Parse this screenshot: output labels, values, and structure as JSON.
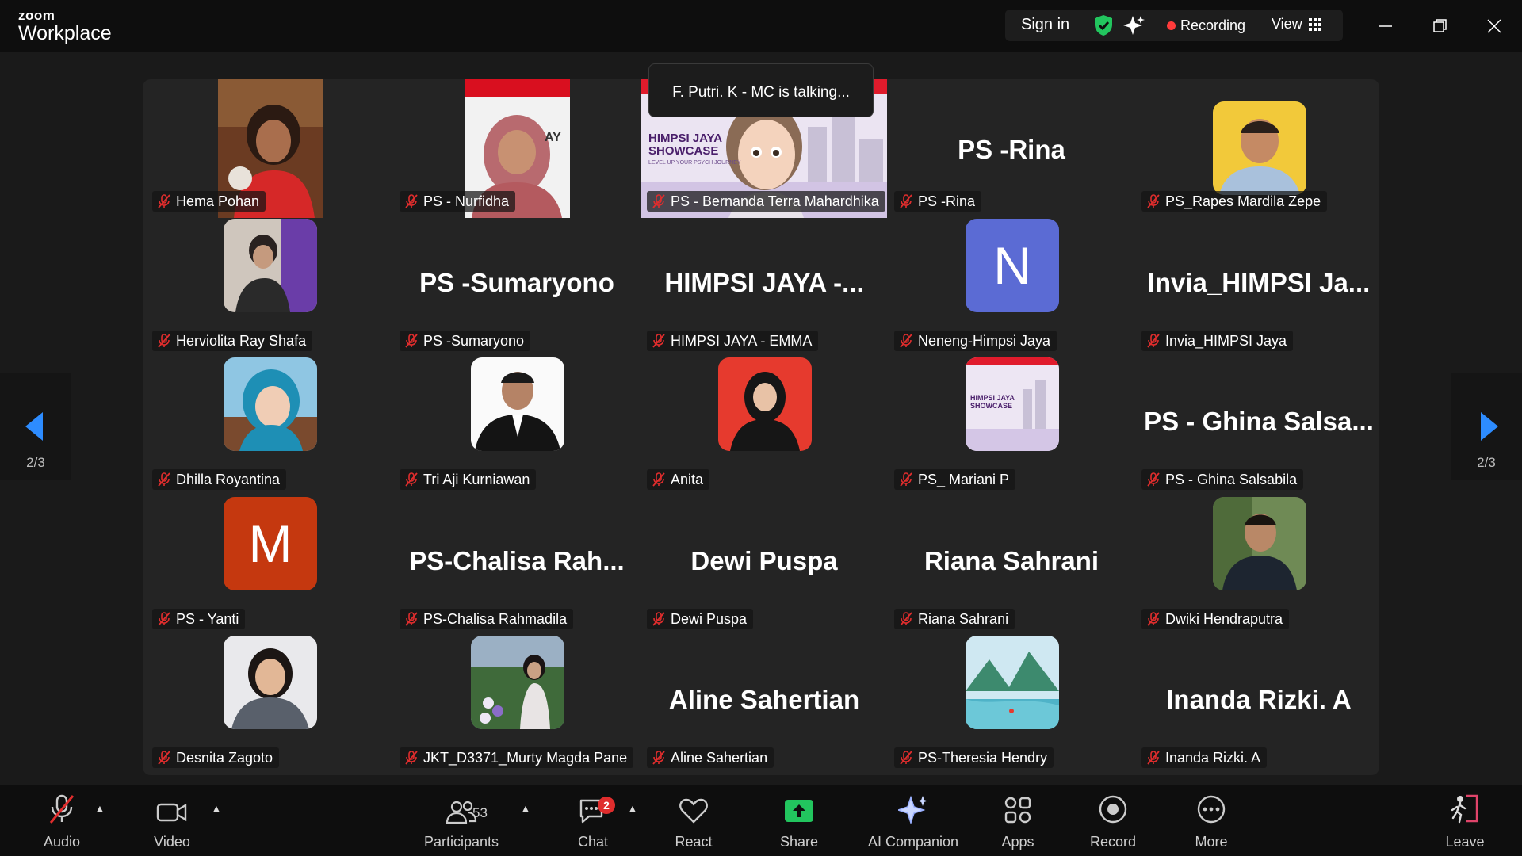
{
  "app": {
    "logo_small": "zoom",
    "logo_big": "Workplace"
  },
  "topbar": {
    "sign_in": "Sign in",
    "recording": "Recording",
    "view": "View"
  },
  "speaking_tooltip": "F. Putri. K - MC is talking...",
  "pagination": {
    "left": "2/3",
    "right": "2/3"
  },
  "tiles": [
    {
      "name": "Hema Pohan"
    },
    {
      "name": "PS - Nurfidha"
    },
    {
      "name": "PS - Bernanda Terra Mahardhika"
    },
    {
      "name": "PS -Rina",
      "display": "PS -Rina"
    },
    {
      "name": "PS_Rapes Mardila Zepe"
    },
    {
      "name": "Herviolita Ray Shafa"
    },
    {
      "name": "PS -Sumaryono",
      "display": "PS -Sumaryono"
    },
    {
      "name": "HIMPSI JAYA - EMMA",
      "display": "HIMPSI  JAYA  -..."
    },
    {
      "name": "Neneng-Himpsi Jaya",
      "initial": "N"
    },
    {
      "name": "Invia_HIMPSI Jaya",
      "display": "Invia_HIMPSI  Ja..."
    },
    {
      "name": "Dhilla Royantina"
    },
    {
      "name": "Tri Aji Kurniawan"
    },
    {
      "name": "Anita"
    },
    {
      "name": "PS_ Mariani P"
    },
    {
      "name": "PS - Ghina Salsabila",
      "display": "PS  -  Ghina  Salsa..."
    },
    {
      "name": "PS - Yanti",
      "initial": "M"
    },
    {
      "name": "PS-Chalisa Rahmadila",
      "display": "PS-Chalisa  Rah..."
    },
    {
      "name": "Dewi Puspa",
      "display": "Dewi  Puspa"
    },
    {
      "name": "Riana Sahrani",
      "display": "Riana  Sahrani"
    },
    {
      "name": "Dwiki Hendraputra"
    },
    {
      "name": "Desnita Zagoto"
    },
    {
      "name": "JKT_D3371_Murty Magda Pane"
    },
    {
      "name": "Aline Sahertian",
      "display": "Aline  Sahertian"
    },
    {
      "name": "PS-Theresia Hendry"
    },
    {
      "name": "Inanda Rizki. A",
      "display": "Inanda  Rizki.  A"
    }
  ],
  "slide_text": {
    "line1": "HIMPSI JAYA",
    "line2": "SHOWCASE",
    "tagline": "LEVEL UP YOUR PSYCH JOURNEY"
  },
  "toolbar": {
    "audio": "Audio",
    "video": "Video",
    "participants": "Participants",
    "participants_count": "53",
    "chat": "Chat",
    "chat_badge": "2",
    "react": "React",
    "share": "Share",
    "ai_companion": "AI Companion",
    "apps": "Apps",
    "record": "Record",
    "more": "More",
    "leave": "Leave"
  },
  "colors": {
    "accent_blue": "#2d8cff",
    "share_green": "#22c55e",
    "recording_red": "#ff3b3b",
    "avatar_N": "#5b6bd4",
    "avatar_M": "#c5380f"
  }
}
